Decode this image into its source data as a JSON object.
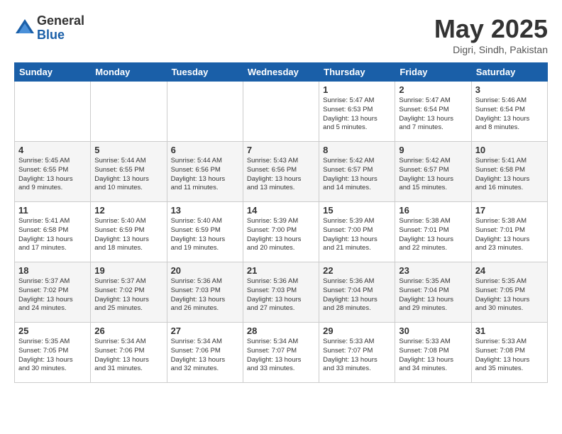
{
  "logo": {
    "general": "General",
    "blue": "Blue"
  },
  "title": {
    "month_year": "May 2025",
    "location": "Digri, Sindh, Pakistan"
  },
  "days_of_week": [
    "Sunday",
    "Monday",
    "Tuesday",
    "Wednesday",
    "Thursday",
    "Friday",
    "Saturday"
  ],
  "weeks": [
    [
      {
        "day": "",
        "info": ""
      },
      {
        "day": "",
        "info": ""
      },
      {
        "day": "",
        "info": ""
      },
      {
        "day": "",
        "info": ""
      },
      {
        "day": "1",
        "info": "Sunrise: 5:47 AM\nSunset: 6:53 PM\nDaylight: 13 hours\nand 5 minutes."
      },
      {
        "day": "2",
        "info": "Sunrise: 5:47 AM\nSunset: 6:54 PM\nDaylight: 13 hours\nand 7 minutes."
      },
      {
        "day": "3",
        "info": "Sunrise: 5:46 AM\nSunset: 6:54 PM\nDaylight: 13 hours\nand 8 minutes."
      }
    ],
    [
      {
        "day": "4",
        "info": "Sunrise: 5:45 AM\nSunset: 6:55 PM\nDaylight: 13 hours\nand 9 minutes."
      },
      {
        "day": "5",
        "info": "Sunrise: 5:44 AM\nSunset: 6:55 PM\nDaylight: 13 hours\nand 10 minutes."
      },
      {
        "day": "6",
        "info": "Sunrise: 5:44 AM\nSunset: 6:56 PM\nDaylight: 13 hours\nand 11 minutes."
      },
      {
        "day": "7",
        "info": "Sunrise: 5:43 AM\nSunset: 6:56 PM\nDaylight: 13 hours\nand 13 minutes."
      },
      {
        "day": "8",
        "info": "Sunrise: 5:42 AM\nSunset: 6:57 PM\nDaylight: 13 hours\nand 14 minutes."
      },
      {
        "day": "9",
        "info": "Sunrise: 5:42 AM\nSunset: 6:57 PM\nDaylight: 13 hours\nand 15 minutes."
      },
      {
        "day": "10",
        "info": "Sunrise: 5:41 AM\nSunset: 6:58 PM\nDaylight: 13 hours\nand 16 minutes."
      }
    ],
    [
      {
        "day": "11",
        "info": "Sunrise: 5:41 AM\nSunset: 6:58 PM\nDaylight: 13 hours\nand 17 minutes."
      },
      {
        "day": "12",
        "info": "Sunrise: 5:40 AM\nSunset: 6:59 PM\nDaylight: 13 hours\nand 18 minutes."
      },
      {
        "day": "13",
        "info": "Sunrise: 5:40 AM\nSunset: 6:59 PM\nDaylight: 13 hours\nand 19 minutes."
      },
      {
        "day": "14",
        "info": "Sunrise: 5:39 AM\nSunset: 7:00 PM\nDaylight: 13 hours\nand 20 minutes."
      },
      {
        "day": "15",
        "info": "Sunrise: 5:39 AM\nSunset: 7:00 PM\nDaylight: 13 hours\nand 21 minutes."
      },
      {
        "day": "16",
        "info": "Sunrise: 5:38 AM\nSunset: 7:01 PM\nDaylight: 13 hours\nand 22 minutes."
      },
      {
        "day": "17",
        "info": "Sunrise: 5:38 AM\nSunset: 7:01 PM\nDaylight: 13 hours\nand 23 minutes."
      }
    ],
    [
      {
        "day": "18",
        "info": "Sunrise: 5:37 AM\nSunset: 7:02 PM\nDaylight: 13 hours\nand 24 minutes."
      },
      {
        "day": "19",
        "info": "Sunrise: 5:37 AM\nSunset: 7:02 PM\nDaylight: 13 hours\nand 25 minutes."
      },
      {
        "day": "20",
        "info": "Sunrise: 5:36 AM\nSunset: 7:03 PM\nDaylight: 13 hours\nand 26 minutes."
      },
      {
        "day": "21",
        "info": "Sunrise: 5:36 AM\nSunset: 7:03 PM\nDaylight: 13 hours\nand 27 minutes."
      },
      {
        "day": "22",
        "info": "Sunrise: 5:36 AM\nSunset: 7:04 PM\nDaylight: 13 hours\nand 28 minutes."
      },
      {
        "day": "23",
        "info": "Sunrise: 5:35 AM\nSunset: 7:04 PM\nDaylight: 13 hours\nand 29 minutes."
      },
      {
        "day": "24",
        "info": "Sunrise: 5:35 AM\nSunset: 7:05 PM\nDaylight: 13 hours\nand 30 minutes."
      }
    ],
    [
      {
        "day": "25",
        "info": "Sunrise: 5:35 AM\nSunset: 7:05 PM\nDaylight: 13 hours\nand 30 minutes."
      },
      {
        "day": "26",
        "info": "Sunrise: 5:34 AM\nSunset: 7:06 PM\nDaylight: 13 hours\nand 31 minutes."
      },
      {
        "day": "27",
        "info": "Sunrise: 5:34 AM\nSunset: 7:06 PM\nDaylight: 13 hours\nand 32 minutes."
      },
      {
        "day": "28",
        "info": "Sunrise: 5:34 AM\nSunset: 7:07 PM\nDaylight: 13 hours\nand 33 minutes."
      },
      {
        "day": "29",
        "info": "Sunrise: 5:33 AM\nSunset: 7:07 PM\nDaylight: 13 hours\nand 33 minutes."
      },
      {
        "day": "30",
        "info": "Sunrise: 5:33 AM\nSunset: 7:08 PM\nDaylight: 13 hours\nand 34 minutes."
      },
      {
        "day": "31",
        "info": "Sunrise: 5:33 AM\nSunset: 7:08 PM\nDaylight: 13 hours\nand 35 minutes."
      }
    ]
  ]
}
